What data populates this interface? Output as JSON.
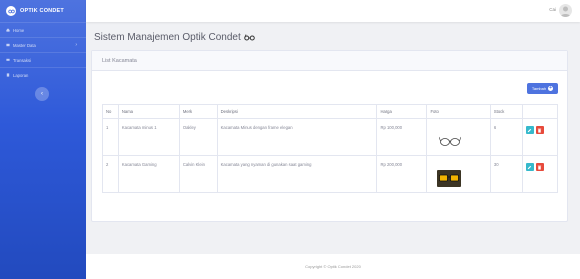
{
  "brand": {
    "name": "OPTIK CONDET"
  },
  "sidebar": {
    "items": [
      {
        "label": "Home",
        "icon": "home-icon"
      },
      {
        "label": "Master Data",
        "icon": "folder-icon",
        "has_children": true
      },
      {
        "label": "Transaksi",
        "icon": "cart-icon"
      },
      {
        "label": "Laporan",
        "icon": "report-icon"
      }
    ],
    "toggle_icon": "chevron-left-icon"
  },
  "topbar": {
    "user_name": "Cai"
  },
  "page": {
    "title": "Sistem Manajemen Optik Condet"
  },
  "card": {
    "header": "List Kacamata",
    "add_button_label": "Tambah"
  },
  "table": {
    "columns": [
      "No",
      "Nama",
      "Merk",
      "Deskripsi",
      "Harga",
      "Foto",
      "Stock",
      ""
    ],
    "rows": [
      {
        "no": "1",
        "nama": "Kacamata minus 1",
        "merk": "Oakley",
        "deskripsi": "Kacamata Minus dengan frame elegan",
        "harga": "Rp 100,000",
        "foto": "glasses-photo",
        "stock": "6"
      },
      {
        "no": "2",
        "nama": "Kacamata Gaming",
        "merk": "Calvin Klein",
        "deskripsi": "Kacamata yang nyaman di gunakan saat gaming",
        "harga": "Rp 200,000",
        "foto": "gaming-glasses-photo",
        "stock": "30"
      }
    ]
  },
  "footer": {
    "text": "Copyright © Optik Condet 2020"
  },
  "colors": {
    "primary": "#4e73df",
    "info": "#36b9cc",
    "danger": "#e74a3b"
  }
}
